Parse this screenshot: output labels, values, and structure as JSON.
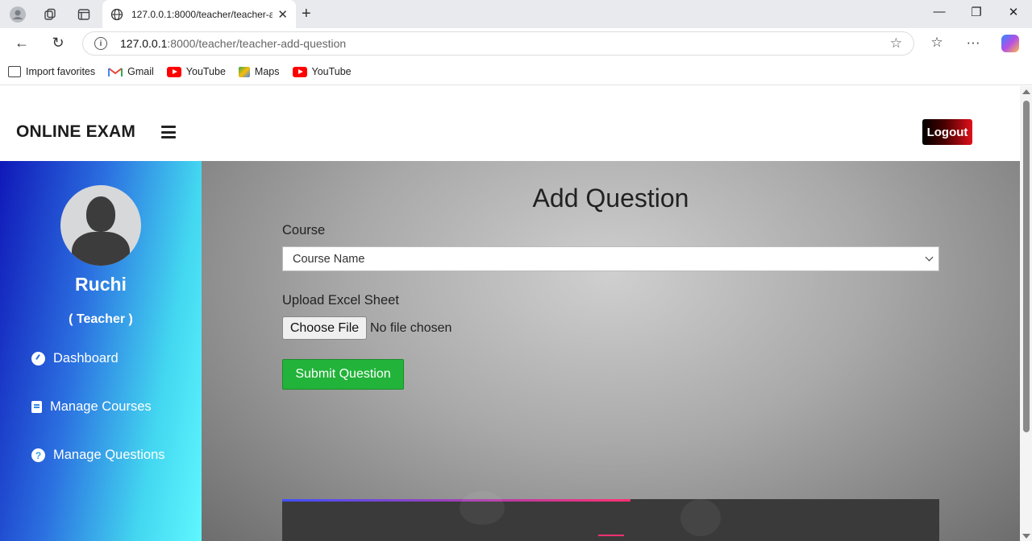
{
  "browser": {
    "tab_title": "127.0.0.1:8000/teacher/teacher-ad",
    "url_host": "127.0.0.1",
    "url_path": ":8000/teacher/teacher-add-question",
    "bookmarks": [
      {
        "label": "Import favorites",
        "icon": "import-icon"
      },
      {
        "label": "Gmail",
        "icon": "gmail-icon"
      },
      {
        "label": "YouTube",
        "icon": "youtube-icon"
      },
      {
        "label": "Maps",
        "icon": "maps-icon"
      },
      {
        "label": "YouTube",
        "icon": "youtube-icon"
      }
    ]
  },
  "header": {
    "brand": "ONLINE EXAM",
    "logout_label": "Logout"
  },
  "sidebar": {
    "user_name": "Ruchi",
    "user_role": "( Teacher )",
    "items": [
      {
        "label": "Dashboard",
        "icon": "dashboard-icon"
      },
      {
        "label": "Manage Courses",
        "icon": "book-icon"
      },
      {
        "label": "Manage Questions",
        "icon": "question-icon"
      }
    ]
  },
  "form": {
    "title": "Add Question",
    "course_label": "Course",
    "course_selected": "Course Name",
    "upload_label": "Upload Excel Sheet",
    "choose_file_label": "Choose File",
    "file_status": "No file chosen",
    "submit_label": "Submit Question"
  },
  "colors": {
    "submit": "#22b33a",
    "logout_end": "#e0101a",
    "sidebar_start": "#1018b8",
    "sidebar_end": "#5ff7ff"
  }
}
